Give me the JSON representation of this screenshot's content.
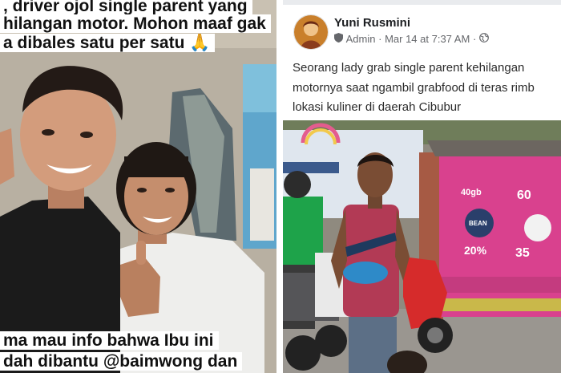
{
  "story": {
    "caption_top": [
      ", driver ojol single parent yang",
      "hilangan motor. Mohon maaf gak",
      "a dibales satu per satu 🙏"
    ],
    "caption_bottom": [
      "ma mau info bahwa Ibu ini",
      "dah dibantu @baimwong dan"
    ]
  },
  "post": {
    "author": "Yuni Rusmini",
    "role": "Admin",
    "separator": "·",
    "date": "Mar 14 at 7:37 AM",
    "text_lines": [
      "Seorang lady grab single parent kehilangan",
      "motornya saat ngambil grabfood di teras rimb",
      "lokasi kuliner di daerah Cibubur"
    ],
    "photo": {
      "signs": [
        "40gb",
        "60",
        "20%",
        "35",
        "BEAN"
      ]
    }
  },
  "colors": {
    "facebook_text": "#1c1e21",
    "facebook_meta": "#65676b",
    "pink_wall": "#d9418e",
    "grab_green": "#1ea34a"
  },
  "icons": [
    "admin-badge-icon",
    "globe-icon",
    "prayer-hands-emoji"
  ]
}
